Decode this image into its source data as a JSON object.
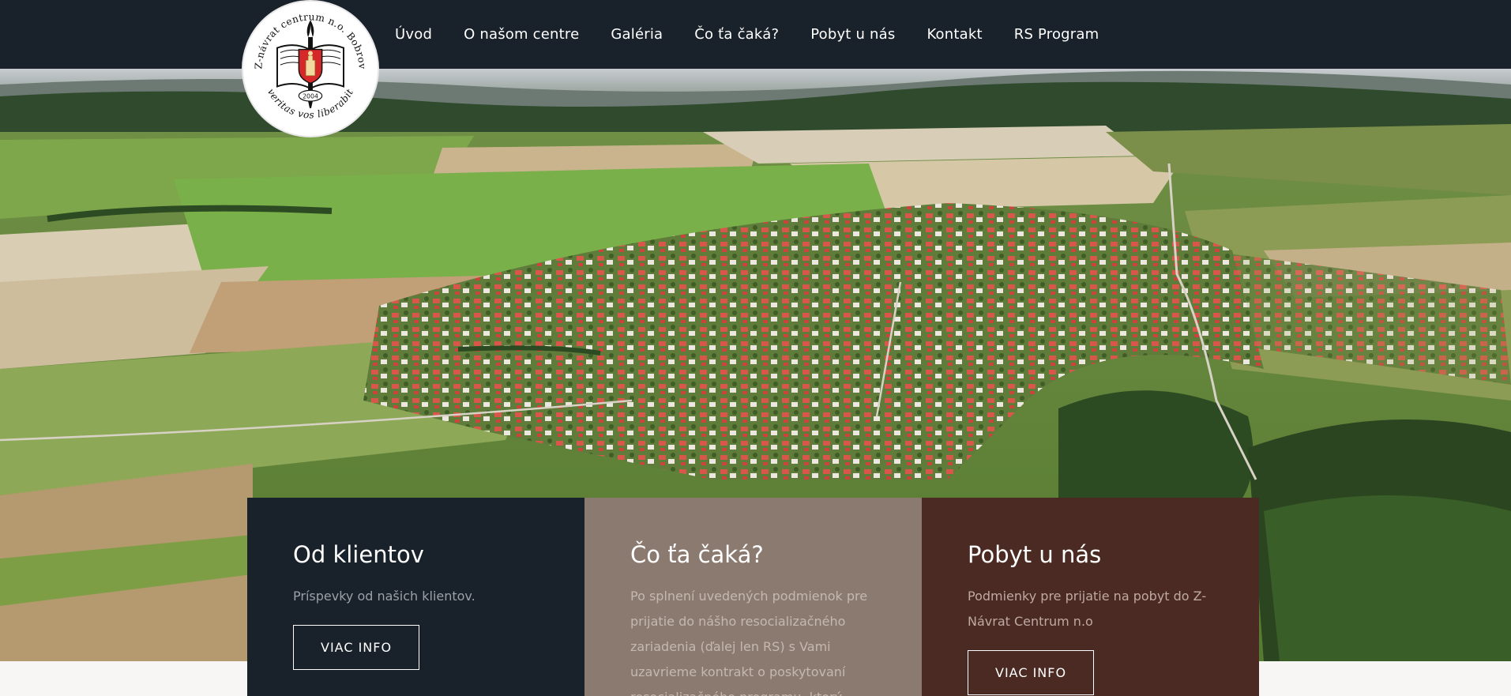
{
  "logo": {
    "ring_top_text": "Z-návrat centrum n.o. Bobrov",
    "ring_bottom_text": "veritas vos liberabit",
    "year": "2004"
  },
  "nav": {
    "items": [
      {
        "label": "Úvod"
      },
      {
        "label": "O našom centre"
      },
      {
        "label": "Galéria"
      },
      {
        "label": "Čo ťa čaká?"
      },
      {
        "label": "Pobyt u nás"
      },
      {
        "label": "Kontakt"
      },
      {
        "label": "RS Program"
      }
    ]
  },
  "cards": [
    {
      "title": "Od klientov",
      "text": "Príspevky od našich klientov.",
      "button": "VIAC INFO"
    },
    {
      "title": "Čo ťa čaká?",
      "text": "Po splnení uvedených podmienok pre prijatie do nášho resocializačného zariadenia (ďalej len RS) s Vami uzavrieme kontrakt o poskytovaní resocializačného programu, ktorý"
    },
    {
      "title": "Pobyt u nás",
      "text": "Podmienky pre prijatie na pobyt do Z-Návrat Centrum n.o",
      "button": "VIAC INFO"
    }
  ],
  "colors": {
    "topbar": "#19212a",
    "card_dark": "#19212a",
    "card_taupe": "#8b7a70",
    "card_brown": "#4a2a22"
  }
}
